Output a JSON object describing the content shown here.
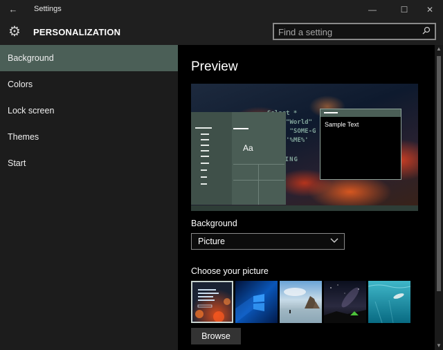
{
  "window": {
    "title": "Settings",
    "back_glyph": "←",
    "minimize_glyph": "—",
    "maximize_glyph": "☐",
    "close_glyph": "✕"
  },
  "header": {
    "title": "PERSONALIZATION",
    "search_placeholder": "Find a setting",
    "gear_icon": "gear-icon",
    "search_icon": "search-icon"
  },
  "sidebar": {
    "items": [
      {
        "label": "Background",
        "active": true
      },
      {
        "label": "Colors",
        "active": false
      },
      {
        "label": "Lock screen",
        "active": false
      },
      {
        "label": "Themes",
        "active": false
      },
      {
        "label": "Start",
        "active": false
      }
    ]
  },
  "main": {
    "preview_heading": "Preview",
    "preview": {
      "tile_text": "Aa",
      "window_text": "Sample Text",
      "code_lines": [
        "Select *",
        "FROM \"World\"",
        "WHERE \"SOME-G",
        "LIKE '%ME%'",
        "",
        "LOADING"
      ]
    },
    "background_label": "Background",
    "background_value": "Picture",
    "choose_label": "Choose your picture",
    "pictures": [
      {
        "name": "abstract-code",
        "selected": true
      },
      {
        "name": "windows-blue",
        "selected": false
      },
      {
        "name": "beach-rocks",
        "selected": false
      },
      {
        "name": "night-sky-tent",
        "selected": false
      },
      {
        "name": "underwater-swimmer",
        "selected": false
      }
    ],
    "browse_label": "Browse"
  },
  "colors": {
    "accent": "#4b5f57",
    "sidebar_bg": "#1c1c1c",
    "main_bg": "#000000"
  }
}
